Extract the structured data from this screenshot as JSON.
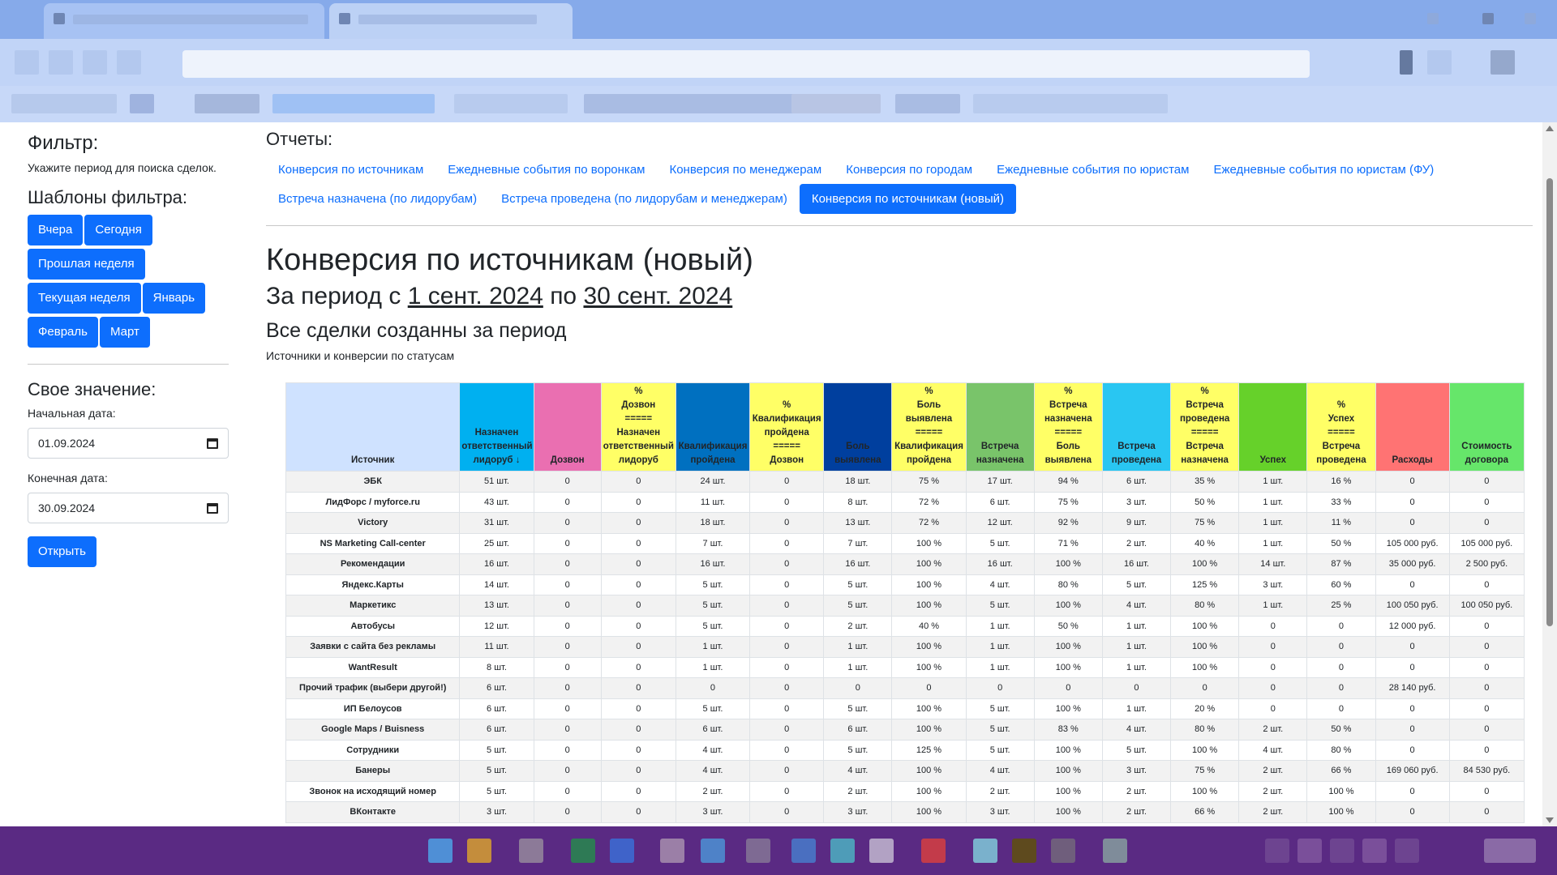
{
  "colors": {
    "primary": "#0d6efd",
    "header_source": "#cfe2ff",
    "header_blue_light": "#00b0f0",
    "header_pink": "#ea6fb1",
    "header_yellow": "#ffff66",
    "header_blue_mid": "#0070c0",
    "header_blue_dark": "#003f9e",
    "header_green_soft": "#79c46a",
    "header_cyan": "#29c6f2",
    "header_green_bright": "#66d12a",
    "header_red": "#ff7373",
    "header_green_light": "#66e66a",
    "taskbar": "#5a2a83"
  },
  "filter": {
    "title": "Фильтр:",
    "subtitle": "Укажите период для поиска сделок.",
    "templates_title": "Шаблоны фильтра:",
    "buttons": [
      "Вчера",
      "Сегодня",
      "Прошлая неделя",
      "Текущая неделя",
      "Январь",
      "Февраль",
      "Март"
    ],
    "custom_title": "Свое значение:",
    "start_label": "Начальная дата:",
    "start_value": "01.09.2024",
    "end_label": "Конечная дата:",
    "end_value": "30.09.2024",
    "open_button": "Открыть"
  },
  "reports": {
    "title": "Отчеты:",
    "tabs_row1": [
      "Конверсия по источникам",
      "Ежедневные события по воронкам",
      "Конверсия по менеджерам",
      "Конверсия по городам",
      "Ежедневные события по юристам",
      "Ежедневные события по юристам (ФУ)"
    ],
    "tabs_row2": [
      "Встреча назначена (по лидорубам)",
      "Встреча проведена (по лидорубам и менеджерам)",
      "Конверсия по источникам (новый)"
    ],
    "active_tab": "Конверсия по источникам (новый)"
  },
  "report": {
    "heading": "Конверсия по источникам (новый)",
    "period_prefix": "За период с",
    "period_start": "1 сент. 2024",
    "period_mid": "по",
    "period_end": "30 сент. 2024",
    "subheading": "Все сделки созданны за период",
    "caption": "Источники и конверсии по статусам"
  },
  "table": {
    "headers": [
      {
        "lines": [
          "Источник"
        ],
        "color": "header_source"
      },
      {
        "lines": [
          "Назначен",
          "ответственный",
          "лидоруб ↓"
        ],
        "color": "header_blue_light"
      },
      {
        "lines": [
          "Дозвон"
        ],
        "color": "header_pink"
      },
      {
        "lines": [
          "%",
          "Дозвон",
          "=====",
          "Назначен",
          "ответственный",
          "лидоруб"
        ],
        "color": "header_yellow"
      },
      {
        "lines": [
          "Квалификация",
          "пройдена"
        ],
        "color": "header_blue_mid"
      },
      {
        "lines": [
          "%",
          "Квалификация",
          "пройдена",
          "=====",
          "Дозвон"
        ],
        "color": "header_yellow"
      },
      {
        "lines": [
          "Боль",
          "выявлена"
        ],
        "color": "header_blue_dark"
      },
      {
        "lines": [
          "%",
          "Боль",
          "выявлена",
          "=====",
          "Квалификация",
          "пройдена"
        ],
        "color": "header_yellow"
      },
      {
        "lines": [
          "Встреча",
          "назначена"
        ],
        "color": "header_green_soft"
      },
      {
        "lines": [
          "%",
          "Встреча",
          "назначена",
          "=====",
          "Боль",
          "выявлена"
        ],
        "color": "header_yellow"
      },
      {
        "lines": [
          "Встреча",
          "проведена"
        ],
        "color": "header_cyan"
      },
      {
        "lines": [
          "%",
          "Встреча",
          "проведена",
          "=====",
          "Встреча",
          "назначена"
        ],
        "color": "header_yellow"
      },
      {
        "lines": [
          "Успех"
        ],
        "color": "header_green_bright"
      },
      {
        "lines": [
          "%",
          "Успех",
          "=====",
          "Встреча",
          "проведена"
        ],
        "color": "header_yellow"
      },
      {
        "lines": [
          "Расходы"
        ],
        "color": "header_red"
      },
      {
        "lines": [
          "Стоимость",
          "договора"
        ],
        "color": "header_green_light"
      }
    ],
    "rows": [
      [
        "ЭБК",
        "51 шт.",
        "0",
        "0",
        "24 шт.",
        "0",
        "18 шт.",
        "75 %",
        "17 шт.",
        "94 %",
        "6 шт.",
        "35 %",
        "1 шт.",
        "16 %",
        "0",
        "0"
      ],
      [
        "ЛидФорс / myforce.ru",
        "43 шт.",
        "0",
        "0",
        "11 шт.",
        "0",
        "8 шт.",
        "72 %",
        "6 шт.",
        "75 %",
        "3 шт.",
        "50 %",
        "1 шт.",
        "33 %",
        "0",
        "0"
      ],
      [
        "Victory",
        "31 шт.",
        "0",
        "0",
        "18 шт.",
        "0",
        "13 шт.",
        "72 %",
        "12 шт.",
        "92 %",
        "9 шт.",
        "75 %",
        "1 шт.",
        "11 %",
        "0",
        "0"
      ],
      [
        "NS Marketing Call-center",
        "25 шт.",
        "0",
        "0",
        "7 шт.",
        "0",
        "7 шт.",
        "100 %",
        "5 шт.",
        "71 %",
        "2 шт.",
        "40 %",
        "1 шт.",
        "50 %",
        "105 000 руб.",
        "105 000 руб."
      ],
      [
        "Рекомендации",
        "16 шт.",
        "0",
        "0",
        "16 шт.",
        "0",
        "16 шт.",
        "100 %",
        "16 шт.",
        "100 %",
        "16 шт.",
        "100 %",
        "14 шт.",
        "87 %",
        "35 000 руб.",
        "2 500 руб."
      ],
      [
        "Яндекс.Карты",
        "14 шт.",
        "0",
        "0",
        "5 шт.",
        "0",
        "5 шт.",
        "100 %",
        "4 шт.",
        "80 %",
        "5 шт.",
        "125 %",
        "3 шт.",
        "60 %",
        "0",
        "0"
      ],
      [
        "Маркетикс",
        "13 шт.",
        "0",
        "0",
        "5 шт.",
        "0",
        "5 шт.",
        "100 %",
        "5 шт.",
        "100 %",
        "4 шт.",
        "80 %",
        "1 шт.",
        "25 %",
        "100 050 руб.",
        "100 050 руб."
      ],
      [
        "Автобусы",
        "12 шт.",
        "0",
        "0",
        "5 шт.",
        "0",
        "2 шт.",
        "40 %",
        "1 шт.",
        "50 %",
        "1 шт.",
        "100 %",
        "0",
        "0",
        "12 000 руб.",
        "0"
      ],
      [
        "Заявки с сайта без рекламы",
        "11 шт.",
        "0",
        "0",
        "1 шт.",
        "0",
        "1 шт.",
        "100 %",
        "1 шт.",
        "100 %",
        "1 шт.",
        "100 %",
        "0",
        "0",
        "0",
        "0"
      ],
      [
        "WantResult",
        "8 шт.",
        "0",
        "0",
        "1 шт.",
        "0",
        "1 шт.",
        "100 %",
        "1 шт.",
        "100 %",
        "1 шт.",
        "100 %",
        "0",
        "0",
        "0",
        "0"
      ],
      [
        "Прочий трафик (выбери другой!)",
        "6 шт.",
        "0",
        "0",
        "0",
        "0",
        "0",
        "0",
        "0",
        "0",
        "0",
        "0",
        "0",
        "0",
        "28 140 руб.",
        "0"
      ],
      [
        "ИП Белоусов",
        "6 шт.",
        "0",
        "0",
        "5 шт.",
        "0",
        "5 шт.",
        "100 %",
        "5 шт.",
        "100 %",
        "1 шт.",
        "20 %",
        "0",
        "0",
        "0",
        "0"
      ],
      [
        "Google Maps / Buisness",
        "6 шт.",
        "0",
        "0",
        "6 шт.",
        "0",
        "6 шт.",
        "100 %",
        "5 шт.",
        "83 %",
        "4 шт.",
        "80 %",
        "2 шт.",
        "50 %",
        "0",
        "0"
      ],
      [
        "Сотрудники",
        "5 шт.",
        "0",
        "0",
        "4 шт.",
        "0",
        "5 шт.",
        "125 %",
        "5 шт.",
        "100 %",
        "5 шт.",
        "100 %",
        "4 шт.",
        "80 %",
        "0",
        "0"
      ],
      [
        "Банеры",
        "5 шт.",
        "0",
        "0",
        "4 шт.",
        "0",
        "4 шт.",
        "100 %",
        "4 шт.",
        "100 %",
        "3 шт.",
        "75 %",
        "2 шт.",
        "66 %",
        "169 060 руб.",
        "84 530 руб."
      ],
      [
        "Звонок на исходящий номер",
        "5 шт.",
        "0",
        "0",
        "2 шт.",
        "0",
        "2 шт.",
        "100 %",
        "2 шт.",
        "100 %",
        "2 шт.",
        "100 %",
        "2 шт.",
        "100 %",
        "0",
        "0"
      ],
      [
        "ВКонтакте",
        "3 шт.",
        "0",
        "0",
        "3 шт.",
        "0",
        "3 шт.",
        "100 %",
        "3 шт.",
        "100 %",
        "2 шт.",
        "66 %",
        "2 шт.",
        "100 %",
        "0",
        "0"
      ]
    ]
  }
}
